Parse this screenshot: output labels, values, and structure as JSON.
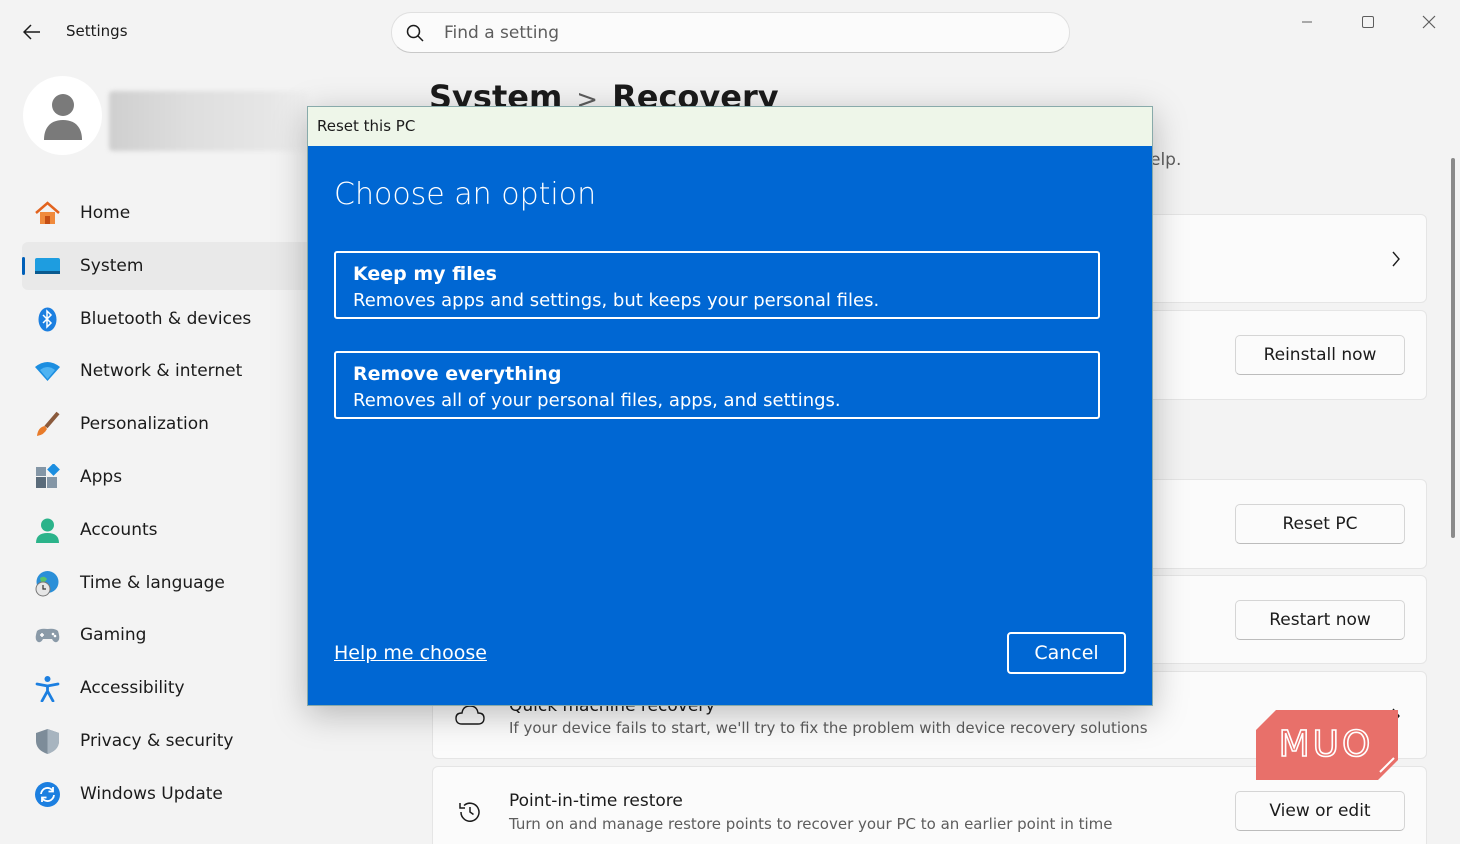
{
  "window": {
    "title": "Settings",
    "back_icon": "arrow-left-icon",
    "controls": [
      "minimize-icon",
      "maximize-icon",
      "close-icon"
    ]
  },
  "search": {
    "placeholder": "Find a setting",
    "value": "",
    "icon": "search-icon"
  },
  "profile": {
    "avatar_icon": "person-icon"
  },
  "sidebar": {
    "items": [
      {
        "label": "Home",
        "icon": "home-icon"
      },
      {
        "label": "System",
        "icon": "system-icon",
        "active": true
      },
      {
        "label": "Bluetooth & devices",
        "icon": "bluetooth-icon"
      },
      {
        "label": "Network & internet",
        "icon": "wifi-icon"
      },
      {
        "label": "Personalization",
        "icon": "brush-icon"
      },
      {
        "label": "Apps",
        "icon": "apps-icon"
      },
      {
        "label": "Accounts",
        "icon": "accounts-icon"
      },
      {
        "label": "Time & language",
        "icon": "globe-clock-icon"
      },
      {
        "label": "Gaming",
        "icon": "gamepad-icon"
      },
      {
        "label": "Accessibility",
        "icon": "accessibility-icon"
      },
      {
        "label": "Privacy & security",
        "icon": "shield-icon"
      },
      {
        "label": "Windows Update",
        "icon": "update-icon"
      }
    ]
  },
  "breadcrumb": {
    "parent": "System",
    "separator": ">",
    "current": "Recovery"
  },
  "content": {
    "intro_peek": "elp.",
    "buttons": {
      "reinstall": "Reinstall now",
      "reset": "Reset PC",
      "restart": "Restart now",
      "view_edit": "View or edit"
    },
    "quick_recovery": {
      "title": "Quick machine recovery",
      "subtitle": "If your device fails to start, we'll try to fix the problem with device recovery solutions",
      "icon": "cloud-icon"
    },
    "point_in_time": {
      "title": "Point-in-time restore",
      "subtitle": "Turn on and manage restore points to recover your PC to an earlier point in time",
      "icon": "history-icon"
    }
  },
  "watermark": {
    "text": "MUO"
  },
  "dialog": {
    "title": "Reset this PC",
    "heading": "Choose an option",
    "options": [
      {
        "title": "Keep my files",
        "description": "Removes apps and settings, but keeps your personal files."
      },
      {
        "title": "Remove everything",
        "description": "Removes all of your personal files, apps, and settings."
      }
    ],
    "help_link": "Help me choose",
    "cancel": "Cancel"
  },
  "colors": {
    "accent": "#005fb8",
    "dialog_bg": "#0067d3",
    "dialog_titlebar": "#eef6e9",
    "watermark": "#e8706a"
  }
}
